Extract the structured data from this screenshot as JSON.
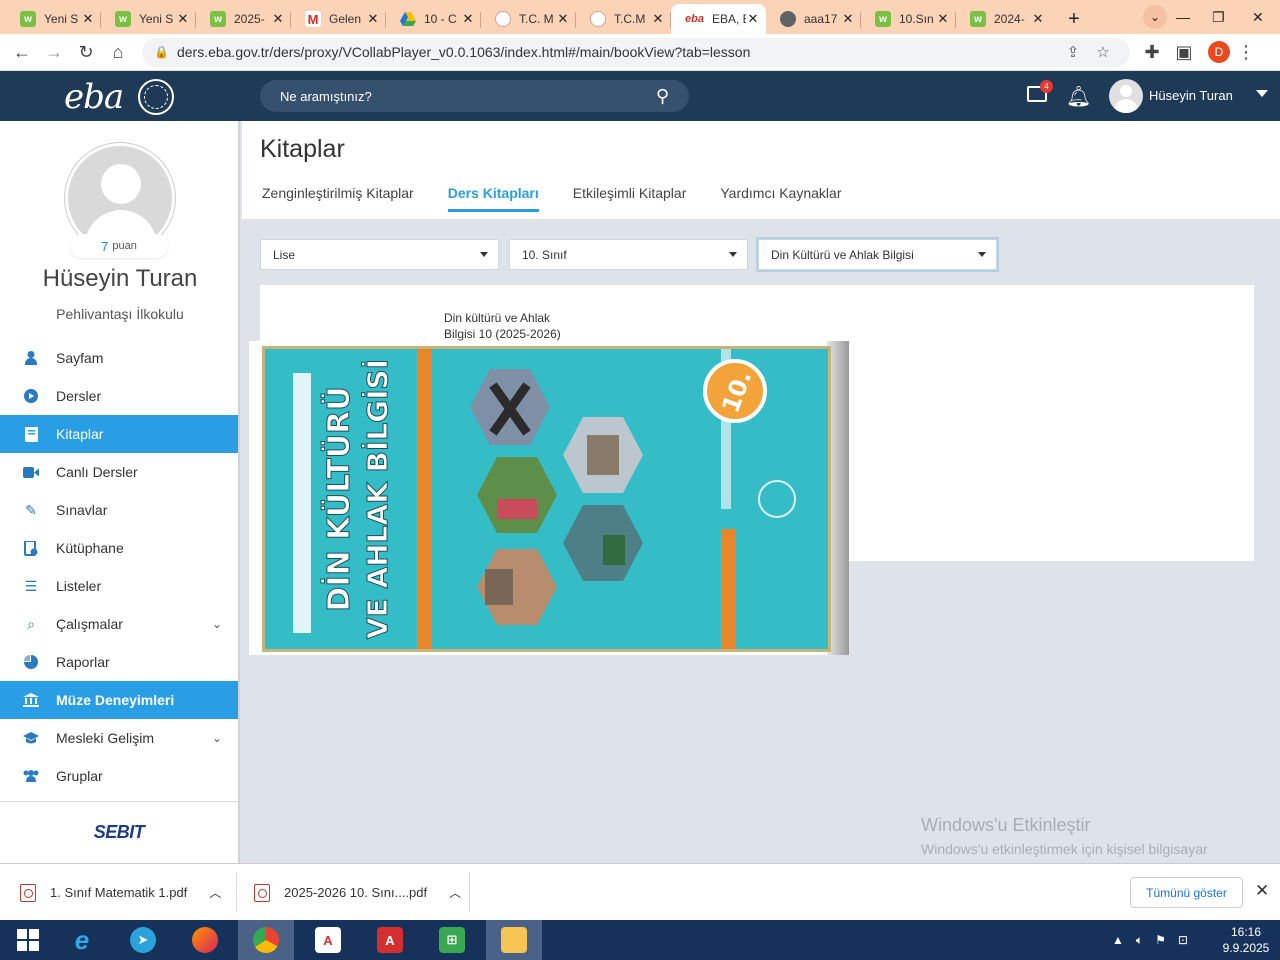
{
  "browser": {
    "tabs": [
      {
        "title": "Yeni S",
        "icon": "eba-icon"
      },
      {
        "title": "Yeni S",
        "icon": "eba-icon"
      },
      {
        "title": "2025-",
        "icon": "eba-icon"
      },
      {
        "title": "Gelen",
        "icon": "gmail-icon"
      },
      {
        "title": "10 - C",
        "icon": "drive-icon"
      },
      {
        "title": "T.C. M",
        "icon": "meb-icon"
      },
      {
        "title": "T.C.M",
        "icon": "meb-icon"
      },
      {
        "title": "EBA, E",
        "icon": "eba-red-icon",
        "active": true
      },
      {
        "title": "aaa17",
        "icon": "globe-icon"
      },
      {
        "title": "10.Sın",
        "icon": "eba-icon"
      },
      {
        "title": "2024-",
        "icon": "eba-icon"
      }
    ],
    "url": "ders.eba.gov.tr/ders/proxy/VCollabPlayer_v0.0.1063/index.html#/main/bookView?tab=lesson",
    "profile_initial": "D"
  },
  "header": {
    "logo": "eba",
    "search_placeholder": "Ne aramıştınız?",
    "mail_badge": "4",
    "user_name": "Hüseyin Turan"
  },
  "sidebar": {
    "points_value": "7",
    "points_label": "puan",
    "name": "Hüseyin Turan",
    "school": "Pehlivantaşı İlkokulu",
    "items": [
      {
        "label": "Sayfam",
        "icon": "user-icon"
      },
      {
        "label": "Dersler",
        "icon": "play-icon"
      },
      {
        "label": "Kitaplar",
        "icon": "book-icon",
        "active": true
      },
      {
        "label": "Canlı Dersler",
        "icon": "video-icon"
      },
      {
        "label": "Sınavlar",
        "icon": "pencil-icon"
      },
      {
        "label": "Kütüphane",
        "icon": "library-icon"
      },
      {
        "label": "Listeler",
        "icon": "list-icon"
      },
      {
        "label": "Çalışmalar",
        "icon": "search-list-icon",
        "expandable": true
      },
      {
        "label": "Raporlar",
        "icon": "pie-chart-icon"
      },
      {
        "label": "Müze Deneyimleri",
        "icon": "museum-icon",
        "highlight": true
      },
      {
        "label": "Mesleki Gelişim",
        "icon": "graduation-icon",
        "expandable": true
      },
      {
        "label": "Gruplar",
        "icon": "group-icon"
      }
    ],
    "footer_logo": "SEBIT"
  },
  "main": {
    "title": "Kitaplar",
    "tabs": [
      {
        "label": "Zenginleştirilmiş Kitaplar"
      },
      {
        "label": "Ders Kitapları",
        "active": true
      },
      {
        "label": "Etkileşimli Kitaplar"
      },
      {
        "label": "Yardımcı Kaynaklar"
      }
    ],
    "filters": {
      "level": "Lise",
      "grade": "10. Sınıf",
      "subject": "Din Kültürü ve Ahlak Bilgisi"
    },
    "book": {
      "title_line1": "Din kültürü ve Ahlak",
      "title_line2": "Bilgisi 10 (2025-2026)",
      "cover_text_1": "DİN KÜLTÜRÜ",
      "cover_text_2": "VE AHLAK BİLGİSİ",
      "cover_grade": "10."
    }
  },
  "watermark": {
    "title": "Windows'u Etkinleştir",
    "text": "Windows'u etkinleştirmek için kişisel bilgisayar ayarlarına gidin."
  },
  "downloads": {
    "items": [
      {
        "name": "1. Sınıf Matematik 1.pdf"
      },
      {
        "name": "2025-2026 10. Sını....pdf"
      }
    ],
    "show_all": "Tümünü göster"
  },
  "taskbar": {
    "time": "16:16",
    "date": "9.9.2025"
  }
}
